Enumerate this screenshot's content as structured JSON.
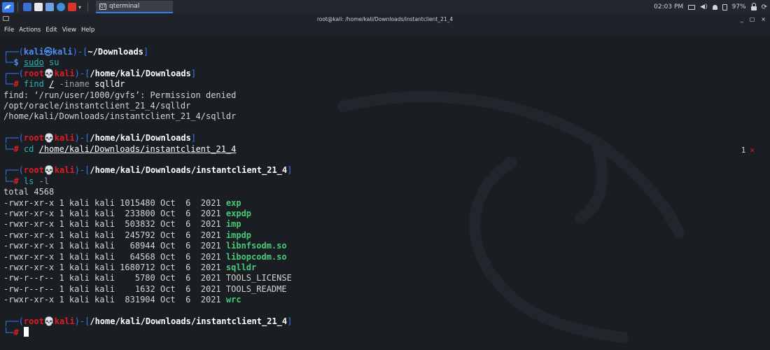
{
  "panel": {
    "task_label": "qterminal",
    "task_icon_text": "QT",
    "clock": "02:03 PM",
    "battery": "97%",
    "icons": [
      "kali-menu-icon",
      "workspace-icon",
      "files-icon",
      "text-editor-icon",
      "firefox-icon",
      "terminal-icon",
      "chevron-down-icon",
      "display-icon",
      "speaker-icon",
      "bell-icon",
      "battery-icon",
      "lock-icon",
      "logout-icon"
    ]
  },
  "window": {
    "title": "root@kali: /home/kali/Downloads/instantclient_21_4",
    "controls": {
      "minimize": "_",
      "maximize": "□",
      "close": "×"
    }
  },
  "menu": [
    "File",
    "Actions",
    "Edit",
    "View",
    "Help"
  ],
  "terminal": {
    "colors": {
      "background": "#1a1d22",
      "prompt_user": "#367bf0",
      "prompt_root": "#e01b24",
      "exec_file": "#47c979",
      "command": "#29b6b6"
    },
    "p1": {
      "tl": "┌──(",
      "user": "kali",
      "at": "㉿",
      "host": "kali",
      "mid": ")-[",
      "path": "~/Downloads",
      "end": "]",
      "bl": "└─",
      "sym": "$",
      "cmd": "sudo",
      "args": " su"
    },
    "root_user": "root",
    "skull": "💀",
    "root_host": "kali",
    "p2": {
      "tl": "┌──(",
      "mid": ")-[",
      "path": "/home/kali/Downloads",
      "end": "]",
      "bl": "└─",
      "sym": "#",
      "cmd": "find",
      "a1": "/",
      "a2": " -iname",
      "a3": " sqlldr"
    },
    "find_out": [
      "find: ‘/run/user/1000/gvfs’: Permission denied",
      "/opt/oracle/instantclient_21_4/sqlldr",
      "/home/kali/Downloads/instantclient_21_4/sqlldr"
    ],
    "p3": {
      "tl": "┌──(",
      "mid": ")-[",
      "path": "/home/kali/Downloads",
      "end": "]",
      "bl": "└─",
      "sym": "#",
      "cmd": "cd",
      "arg": "/home/kali/Downloads/instantclient_21_4"
    },
    "exit_status": {
      "code": "1",
      "mark": "✕"
    },
    "p4": {
      "tl": "┌──(",
      "mid": ")-[",
      "path": "/home/kali/Downloads/instantclient_21_4",
      "end": "]",
      "bl": "└─",
      "sym": "#",
      "cmd": "ls",
      "args": " -l"
    },
    "total": "total 4568",
    "listing": [
      {
        "meta": "-rwxr-xr-x 1 kali kali 1015480 Oct  6  2021 ",
        "name": "exp",
        "exec": true
      },
      {
        "meta": "-rwxr-xr-x 1 kali kali  233800 Oct  6  2021 ",
        "name": "expdp",
        "exec": true
      },
      {
        "meta": "-rwxr-xr-x 1 kali kali  503832 Oct  6  2021 ",
        "name": "imp",
        "exec": true
      },
      {
        "meta": "-rwxr-xr-x 1 kali kali  245792 Oct  6  2021 ",
        "name": "impdp",
        "exec": true
      },
      {
        "meta": "-rwxr-xr-x 1 kali kali   68944 Oct  6  2021 ",
        "name": "libnfsodm.so",
        "exec": true
      },
      {
        "meta": "-rwxr-xr-x 1 kali kali   64568 Oct  6  2021 ",
        "name": "libopcodm.so",
        "exec": true
      },
      {
        "meta": "-rwxr-xr-x 1 kali kali 1680712 Oct  6  2021 ",
        "name": "sqlldr",
        "exec": true
      },
      {
        "meta": "-rw-r--r-- 1 kali kali    5780 Oct  6  2021 ",
        "name": "TOOLS_LICENSE",
        "exec": false
      },
      {
        "meta": "-rw-r--r-- 1 kali kali    1632 Oct  6  2021 ",
        "name": "TOOLS_README",
        "exec": false
      },
      {
        "meta": "-rwxr-xr-x 1 kali kali  831904 Oct  6  2021 ",
        "name": "wrc",
        "exec": true
      }
    ],
    "p5": {
      "tl": "┌──(",
      "mid": ")-[",
      "path": "/home/kali/Downloads/instantclient_21_4",
      "end": "]",
      "bl": "└─",
      "sym": "#"
    }
  }
}
